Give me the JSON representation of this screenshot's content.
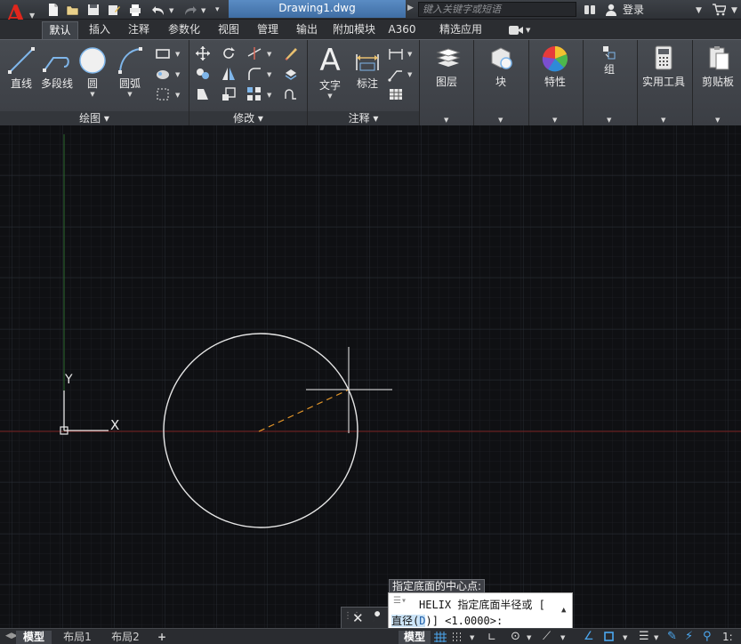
{
  "title_bar": {
    "document_title": "Drawing1.dwg",
    "search_placeholder": "键入关键字或短语",
    "login_label": "登录",
    "app_letter": "A"
  },
  "tabs": [
    {
      "label": "默认",
      "active": true
    },
    {
      "label": "插入"
    },
    {
      "label": "注释"
    },
    {
      "label": "参数化"
    },
    {
      "label": "视图"
    },
    {
      "label": "管理"
    },
    {
      "label": "输出"
    },
    {
      "label": "附加模块"
    },
    {
      "label": "A360"
    },
    {
      "label": "精选应用"
    }
  ],
  "ribbon": {
    "draw": {
      "line": "直线",
      "polyline": "多段线",
      "circle": "圆",
      "arc": "圆弧",
      "panel_title": "绘图 ▾"
    },
    "modify": {
      "panel_title": "修改 ▾"
    },
    "annotation": {
      "text": "文字",
      "dimension": "标注",
      "panel_title": "注释 ▾"
    },
    "layers": "图层",
    "block": "块",
    "properties": "特性",
    "group": "组",
    "utilities": "实用工具",
    "clipboard": "剪贴板"
  },
  "canvas": {
    "ucs_y": "Y",
    "ucs_x": "X",
    "background": "#0f1013",
    "x_axis_color": "#7a1e1e",
    "y_axis_color": "#2c6a2c"
  },
  "command": {
    "tooltip": "指定底面的中心点:",
    "line1": "HELIX 指定底面半径或 [",
    "line2_prefix": "直径(",
    "line2_key": "D",
    "line2_suffix": ")] <1.0000>:"
  },
  "layout_tabs": [
    {
      "label": "模型",
      "active": true
    },
    {
      "label": "布局1"
    },
    {
      "label": "布局2"
    }
  ],
  "status": {
    "model_label": "模型",
    "scale_label": "1:"
  }
}
